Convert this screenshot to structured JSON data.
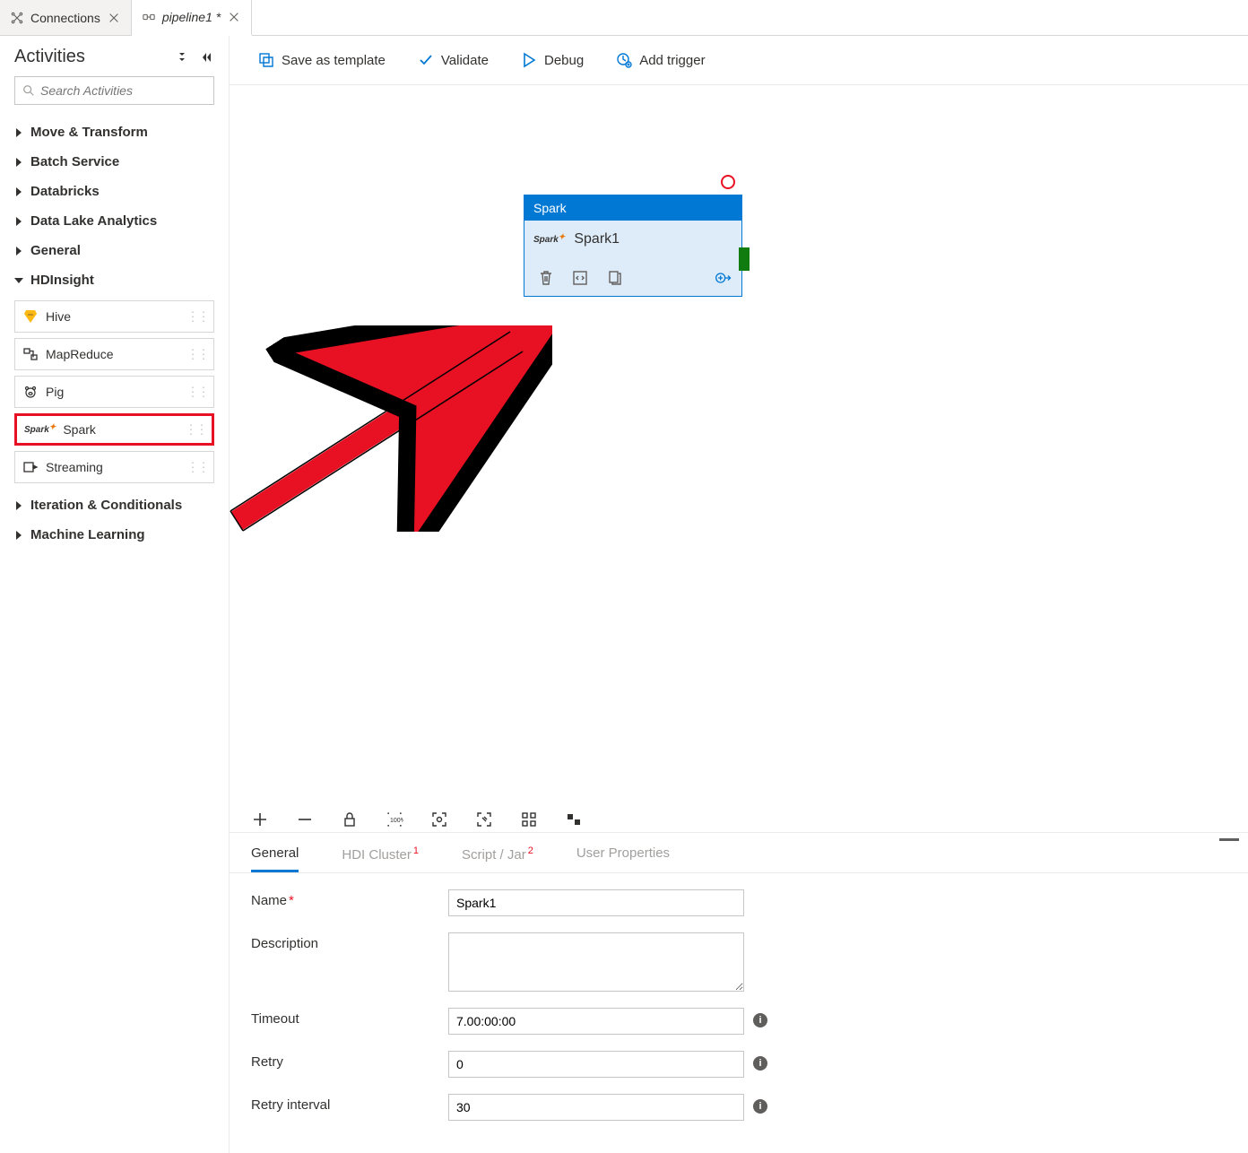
{
  "tabs": [
    {
      "label": "Connections",
      "icon": "connections",
      "active": false,
      "italic": false
    },
    {
      "label": "pipeline1 *",
      "icon": "pipeline",
      "active": true,
      "italic": true
    }
  ],
  "sidebar": {
    "title": "Activities",
    "search_placeholder": "Search Activities",
    "categories": [
      {
        "label": "Move & Transform",
        "expanded": false
      },
      {
        "label": "Batch Service",
        "expanded": false
      },
      {
        "label": "Databricks",
        "expanded": false
      },
      {
        "label": "Data Lake Analytics",
        "expanded": false
      },
      {
        "label": "General",
        "expanded": false
      },
      {
        "label": "HDInsight",
        "expanded": true,
        "items": [
          {
            "label": "Hive",
            "icon": "hive"
          },
          {
            "label": "MapReduce",
            "icon": "mapreduce"
          },
          {
            "label": "Pig",
            "icon": "pig"
          },
          {
            "label": "Spark",
            "icon": "spark",
            "highlight": true
          },
          {
            "label": "Streaming",
            "icon": "streaming"
          }
        ]
      },
      {
        "label": "Iteration & Conditionals",
        "expanded": false
      },
      {
        "label": "Machine Learning",
        "expanded": false
      }
    ]
  },
  "toolbar": {
    "save_template": "Save as template",
    "validate": "Validate",
    "debug": "Debug",
    "add_trigger": "Add trigger"
  },
  "canvas_node": {
    "type_label": "Spark",
    "name": "Spark1"
  },
  "prop_tabs": {
    "general": "General",
    "hdi_cluster": "HDI Cluster",
    "hdi_badge": "1",
    "script_jar": "Script / Jar",
    "script_badge": "2",
    "user_props": "User Properties"
  },
  "form": {
    "name_label": "Name",
    "name_value": "Spark1",
    "desc_label": "Description",
    "desc_value": "",
    "timeout_label": "Timeout",
    "timeout_value": "7.00:00:00",
    "retry_label": "Retry",
    "retry_value": "0",
    "retry_interval_label": "Retry interval",
    "retry_interval_value": "30"
  }
}
